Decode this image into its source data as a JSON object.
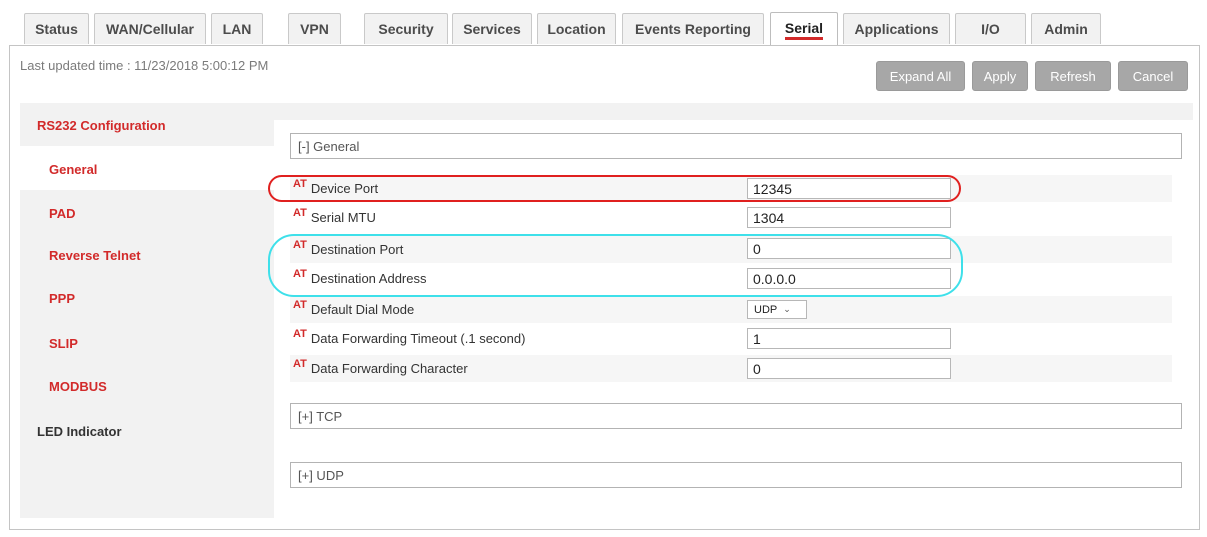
{
  "tabs": [
    {
      "label": "Status",
      "active": false
    },
    {
      "label": "WAN/Cellular",
      "active": false
    },
    {
      "label": "LAN",
      "active": false
    },
    {
      "label": "VPN",
      "active": false
    },
    {
      "label": "Security",
      "active": false
    },
    {
      "label": "Services",
      "active": false
    },
    {
      "label": "Location",
      "active": false
    },
    {
      "label": "Events Reporting",
      "active": false
    },
    {
      "label": "Serial",
      "active": true
    },
    {
      "label": "Applications",
      "active": false
    },
    {
      "label": "I/O",
      "active": false
    },
    {
      "label": "Admin",
      "active": false
    }
  ],
  "last_updated": "Last updated time : 11/23/2018 5:00:12 PM",
  "buttons": {
    "expand_all": "Expand All",
    "apply": "Apply",
    "refresh": "Refresh",
    "cancel": "Cancel"
  },
  "sidebar": {
    "header": "RS232 Configuration",
    "items": [
      "General",
      "PAD",
      "Reverse Telnet",
      "PPP",
      "SLIP",
      "MODBUS"
    ],
    "active": "General",
    "led": "LED Indicator"
  },
  "sections": {
    "general": "[-] General",
    "tcp": "[+] TCP",
    "udp": "[+] UDP"
  },
  "at_badge": "AT",
  "fields": {
    "device_port": {
      "label": "Device Port",
      "value": "12345"
    },
    "serial_mtu": {
      "label": "Serial MTU",
      "value": "1304"
    },
    "destination_port": {
      "label": "Destination Port",
      "value": "0"
    },
    "destination_address": {
      "label": "Destination Address",
      "value": "0.0.0.0"
    },
    "default_dial_mode": {
      "label": "Default Dial Mode",
      "value": "UDP"
    },
    "data_forwarding_timeout": {
      "label": "Data Forwarding Timeout (.1 second)",
      "value": "1"
    },
    "data_forwarding_character": {
      "label": "Data Forwarding Character",
      "value": "0"
    }
  },
  "colors": {
    "accent_red": "#d22a2a",
    "highlight_red": "#e0201f",
    "highlight_cyan": "#3ee0ea",
    "button_gray": "#a7a7a7"
  }
}
